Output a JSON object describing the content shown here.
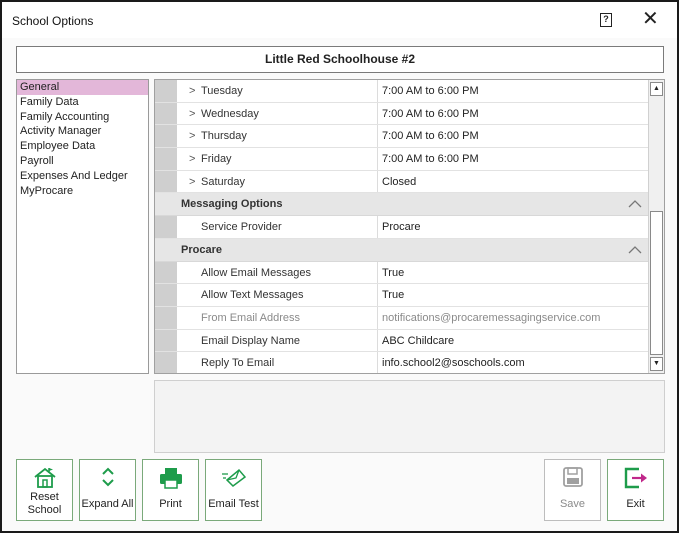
{
  "window": {
    "title": "School Options"
  },
  "school_name": "Little Red Schoolhouse #2",
  "nav": {
    "items": [
      "General",
      "Family Data",
      "Family Accounting",
      "Activity Manager",
      "Employee Data",
      "Payroll",
      "Expenses And Ledger",
      "MyProcare"
    ],
    "selected": "General"
  },
  "grid": {
    "days": [
      {
        "name": "Tuesday",
        "value": "7:00 AM to 6:00 PM"
      },
      {
        "name": "Wednesday",
        "value": "7:00 AM to 6:00 PM"
      },
      {
        "name": "Thursday",
        "value": "7:00 AM to 6:00 PM"
      },
      {
        "name": "Friday",
        "value": "7:00 AM to 6:00 PM"
      },
      {
        "name": "Saturday",
        "value": "Closed"
      }
    ],
    "messaging": {
      "header": "Messaging Options",
      "rows": [
        {
          "name": "Service Provider",
          "value": "Procare"
        }
      ]
    },
    "procare": {
      "header": "Procare",
      "rows": [
        {
          "name": "Allow Email Messages",
          "value": "True"
        },
        {
          "name": "Allow Text Messages",
          "value": "True"
        },
        {
          "name": "From Email Address",
          "value": "notifications@procaremessagingservice.com"
        },
        {
          "name": "Email Display Name",
          "value": "ABC Childcare"
        },
        {
          "name": "Reply To Email",
          "value": "info.school2@soschools.com"
        }
      ]
    }
  },
  "buttons": {
    "reset_school": [
      "Reset",
      "School"
    ],
    "expand_all": "Expand All",
    "print": "Print",
    "email_test": "Email Test",
    "save": "Save",
    "exit": "Exit"
  },
  "colors": {
    "accent_green": "#1e9c4b",
    "selected_nav": "#e3b7d9",
    "exit_magenta": "#c0278a"
  }
}
